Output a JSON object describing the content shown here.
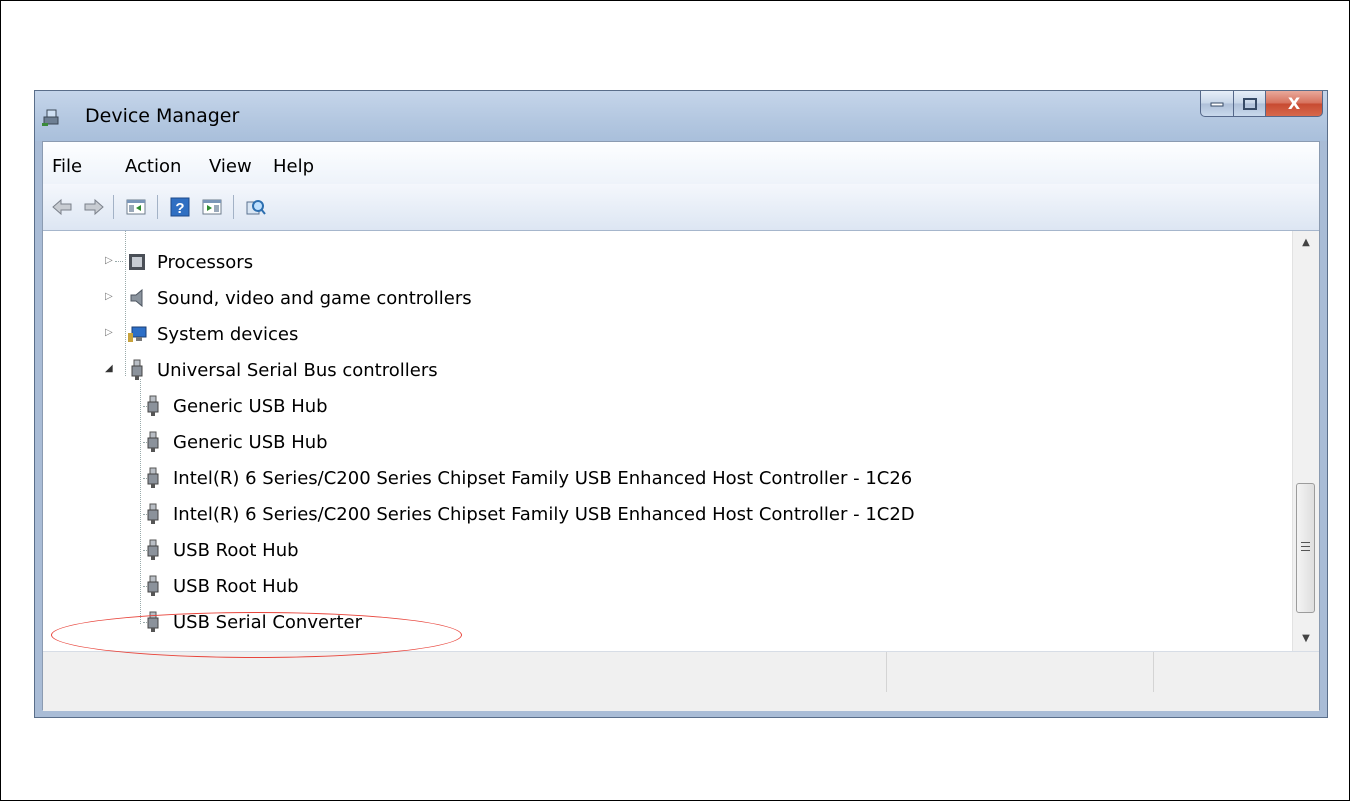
{
  "window": {
    "title": "Device Manager",
    "icon": "device-manager-icon",
    "caption_buttons": {
      "minimize": "–",
      "maximize": "□",
      "close": "X"
    }
  },
  "menu": [
    "File",
    "Action",
    "View",
    "Help"
  ],
  "toolbar": [
    "back-icon",
    "forward-icon",
    "show-hide-console-tree-icon",
    "help-icon",
    "action-pane-icon",
    "scan-hardware-icon"
  ],
  "tree": {
    "categories": [
      {
        "label": "Processors",
        "icon": "processor-icon",
        "expanded": false
      },
      {
        "label": "Sound, video and game controllers",
        "icon": "speaker-icon",
        "expanded": false
      },
      {
        "label": "System devices",
        "icon": "system-devices-icon",
        "expanded": false
      },
      {
        "label": "Universal Serial Bus controllers",
        "icon": "usb-plug-icon",
        "expanded": true
      }
    ],
    "usb_children": [
      "Generic USB Hub",
      "Generic USB Hub",
      "Intel(R) 6 Series/C200 Series Chipset Family USB Enhanced Host Controller - 1C26",
      "Intel(R) 6 Series/C200 Series Chipset Family USB Enhanced Host Controller - 1C2D",
      "USB Root Hub",
      "USB Root Hub",
      "USB Serial Converter"
    ],
    "highlighted_item": "USB Serial Converter",
    "highlight_color": "#e8453c"
  },
  "scrollbar": {
    "up": "▲",
    "down": "▼"
  }
}
